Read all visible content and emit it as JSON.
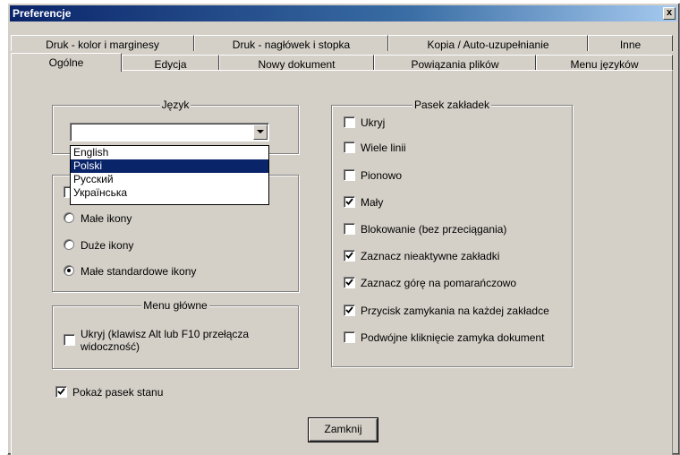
{
  "window": {
    "title": "Preferencje",
    "close_label": "x"
  },
  "tabs_back": [
    {
      "label": "Druk - kolor i marginesy"
    },
    {
      "label": "Druk - nagłówek i stopka"
    },
    {
      "label": "Kopia / Auto-uzupełnianie"
    },
    {
      "label": "Inne"
    }
  ],
  "tabs_front": [
    {
      "label": "Ogólne",
      "active": true
    },
    {
      "label": "Edycja"
    },
    {
      "label": "Nowy dokument"
    },
    {
      "label": "Powiązania plików"
    },
    {
      "label": "Menu języków"
    }
  ],
  "language_group": {
    "title": "Język",
    "selected_value": "",
    "options": [
      {
        "label": "English"
      },
      {
        "label": "Polski",
        "highlighted": true
      },
      {
        "label": "Русский"
      },
      {
        "label": "Українська"
      }
    ]
  },
  "toolbar_group": {
    "options": [
      {
        "label": "Małe ikony",
        "selected": false
      },
      {
        "label": "Duże ikony",
        "selected": false
      },
      {
        "label": "Małe standardowe ikony",
        "selected": true
      }
    ]
  },
  "main_menu_group": {
    "title": "Menu główne",
    "hide_label_line1": "Ukryj (klawisz Alt lub F10 przełącza",
    "hide_label_line2": "widoczność)",
    "hide_checked": false
  },
  "tab_bar_group": {
    "title": "Pasek zakładek",
    "options": [
      {
        "label": "Ukryj",
        "checked": false
      },
      {
        "label": "Wiele linii",
        "checked": false
      },
      {
        "label": "Pionowo",
        "checked": false
      },
      {
        "label": "Mały",
        "checked": true
      },
      {
        "label": "Blokowanie (bez przeciągania)",
        "checked": false
      },
      {
        "label": "Zaznacz nieaktywne zakładki",
        "checked": true
      },
      {
        "label": "Zaznacz górę na pomarańczowo",
        "checked": true
      },
      {
        "label": "Przycisk zamykania na każdej zakładce",
        "checked": true
      },
      {
        "label": "Podwójne kliknięcie zamyka dokument",
        "checked": false
      }
    ]
  },
  "status_bar": {
    "label": "Pokaż pasek stanu",
    "checked": true
  },
  "close_button": {
    "label": "Zamknij"
  }
}
